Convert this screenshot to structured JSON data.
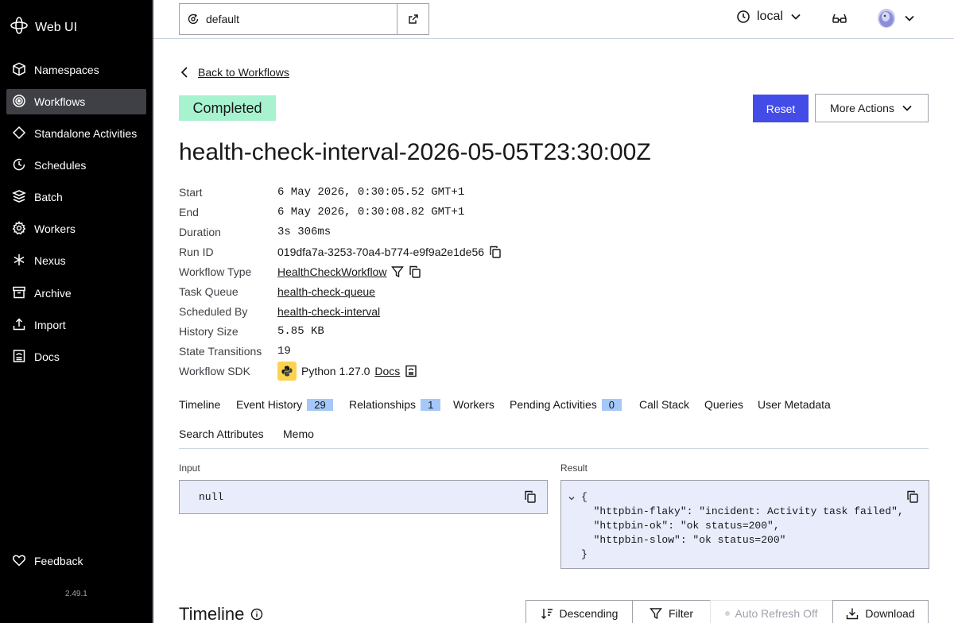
{
  "app": {
    "name": "Web UI",
    "version": "2.49.1"
  },
  "sidebar": {
    "items": [
      {
        "label": "Namespaces",
        "icon": "cube-icon"
      },
      {
        "label": "Workflows",
        "icon": "workflows-icon",
        "active": true
      },
      {
        "label": "Standalone Activities",
        "icon": "diamond-icon"
      },
      {
        "label": "Schedules",
        "icon": "schedule-icon"
      },
      {
        "label": "Batch",
        "icon": "layers-icon"
      },
      {
        "label": "Workers",
        "icon": "gear-icon"
      },
      {
        "label": "Nexus",
        "icon": "nexus-icon"
      },
      {
        "label": "Archive",
        "icon": "archive-icon"
      },
      {
        "label": "Import",
        "icon": "upload-icon"
      },
      {
        "label": "Docs",
        "icon": "book-icon"
      }
    ],
    "feedback_label": "Feedback"
  },
  "topbar": {
    "namespace": "default",
    "cluster": "local"
  },
  "back_link": "Back to Workflows",
  "status": {
    "label": "Completed",
    "color": "#a7f3d0"
  },
  "actions": {
    "reset": "Reset",
    "more": "More Actions",
    "accent": "#444ce7"
  },
  "workflow": {
    "title": "health-check-interval-2026-05-05T23:30:00Z",
    "details": {
      "start": {
        "label": "Start",
        "value": "6 May 2026, 0:30:05.52 GMT+1"
      },
      "end": {
        "label": "End",
        "value": "6 May 2026, 0:30:08.82 GMT+1"
      },
      "duration": {
        "label": "Duration",
        "value": "3s 306ms"
      },
      "run_id": {
        "label": "Run ID",
        "value": "019dfa7a-3253-70a4-b774-e9f9a2e1de56"
      },
      "workflow_type": {
        "label": "Workflow Type",
        "value": "HealthCheckWorkflow"
      },
      "task_queue": {
        "label": "Task Queue",
        "value": "health-check-queue"
      },
      "scheduled_by": {
        "label": "Scheduled By",
        "value": "health-check-interval"
      },
      "history_size": {
        "label": "History Size",
        "value": "5.85 KB"
      },
      "state_transitions": {
        "label": "State Transitions",
        "value": "19"
      },
      "sdk": {
        "label": "Workflow SDK",
        "value": "Python 1.27.0",
        "docs": "Docs"
      }
    }
  },
  "tabs": [
    {
      "label": "Timeline"
    },
    {
      "label": "Event History",
      "count": "29"
    },
    {
      "label": "Relationships",
      "count": "1"
    },
    {
      "label": "Workers"
    },
    {
      "label": "Pending Activities",
      "count": "0"
    },
    {
      "label": "Call Stack"
    },
    {
      "label": "Queries"
    },
    {
      "label": "User Metadata"
    },
    {
      "label": "Search Attributes"
    },
    {
      "label": "Memo"
    }
  ],
  "input": {
    "label": "Input",
    "value": "null"
  },
  "result": {
    "label": "Result",
    "lines": [
      "{",
      "  \"httpbin-flaky\": \"incident: Activity task failed\",",
      "  \"httpbin-ok\": \"ok status=200\",",
      "  \"httpbin-slow\": \"ok status=200\"",
      "}"
    ]
  },
  "timeline": {
    "title": "Timeline",
    "descending": "Descending",
    "filter": "Filter",
    "auto_refresh": "Auto Refresh Off",
    "download": "Download"
  }
}
